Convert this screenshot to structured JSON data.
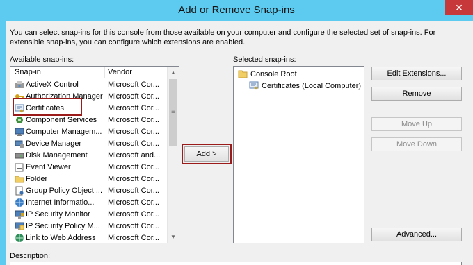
{
  "window": {
    "title": "Add or Remove Snap-ins",
    "close_label": "✕"
  },
  "intro_text": "You can select snap-ins for this console from those available on your computer and configure the selected set of snap-ins. For extensible snap-ins, you can configure which extensions are enabled.",
  "available": {
    "label": "Available snap-ins:",
    "col_snapin": "Snap-in",
    "col_vendor": "Vendor",
    "items": [
      {
        "name": "ActiveX Control",
        "vendor": "Microsoft Cor...",
        "icon": "activex-icon"
      },
      {
        "name": "Authorization Manager",
        "vendor": "Microsoft Cor...",
        "icon": "authorization-icon"
      },
      {
        "name": "Certificates",
        "vendor": "Microsoft Cor...",
        "icon": "certificate-icon"
      },
      {
        "name": "Component Services",
        "vendor": "Microsoft Cor...",
        "icon": "component-services-icon"
      },
      {
        "name": "Computer Managem...",
        "vendor": "Microsoft Cor...",
        "icon": "computer-management-icon"
      },
      {
        "name": "Device Manager",
        "vendor": "Microsoft Cor...",
        "icon": "device-manager-icon"
      },
      {
        "name": "Disk Management",
        "vendor": "Microsoft and...",
        "icon": "disk-management-icon"
      },
      {
        "name": "Event Viewer",
        "vendor": "Microsoft Cor...",
        "icon": "event-viewer-icon"
      },
      {
        "name": "Folder",
        "vendor": "Microsoft Cor...",
        "icon": "folder-icon"
      },
      {
        "name": "Group Policy Object ...",
        "vendor": "Microsoft Cor...",
        "icon": "group-policy-icon"
      },
      {
        "name": "Internet Informatio...",
        "vendor": "Microsoft Cor...",
        "icon": "iis-icon"
      },
      {
        "name": "IP Security Monitor",
        "vendor": "Microsoft Cor...",
        "icon": "ip-security-monitor-icon"
      },
      {
        "name": "IP Security Policy M...",
        "vendor": "Microsoft Cor...",
        "icon": "ip-security-policy-icon"
      },
      {
        "name": "Link to Web Address",
        "vendor": "Microsoft Cor...",
        "icon": "link-icon"
      }
    ]
  },
  "selected": {
    "label": "Selected snap-ins:",
    "root": "Console Root",
    "child": "Certificates (Local Computer)"
  },
  "buttons": {
    "add": "Add >",
    "edit_extensions": "Edit Extensions...",
    "remove": "Remove",
    "move_up": "Move Up",
    "move_down": "Move Down",
    "advanced": "Advanced..."
  },
  "description_label": "Description:",
  "colors": {
    "titlebar": "#5dcaf0",
    "close": "#c7383a",
    "highlight": "#9b1b1b"
  }
}
